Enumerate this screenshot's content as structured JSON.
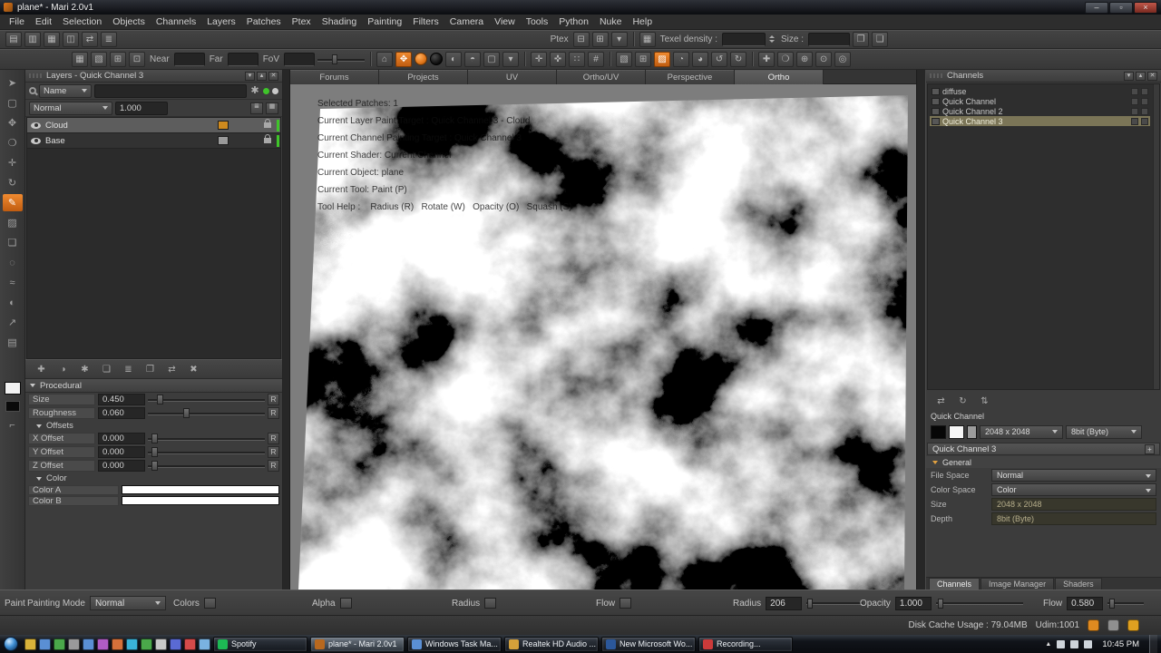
{
  "colors": {
    "accent_orange": "#e0761a",
    "indicator_green": "#3fc42a",
    "selected_channel_olive": "#7b7557"
  },
  "window": {
    "title": "plane* - Mari 2.0v1",
    "minimize_label": "–",
    "maximize_label": "▫",
    "close_label": "×"
  },
  "menubar": {
    "items": [
      "File",
      "Edit",
      "Selection",
      "Objects",
      "Channels",
      "Layers",
      "Patches",
      "Ptex",
      "Shading",
      "Painting",
      "Filters",
      "Camera",
      "View",
      "Tools",
      "Python",
      "Nuke",
      "Help"
    ]
  },
  "toolbar1": {
    "left_icons": [
      {
        "name": "new-project-icon",
        "glyph": "▤"
      },
      {
        "name": "open-project-icon",
        "glyph": "▥"
      },
      {
        "name": "save-project-icon",
        "glyph": "▦"
      },
      {
        "name": "import-archive-icon",
        "glyph": "◫"
      },
      {
        "name": "export-archive-icon",
        "glyph": "⇄"
      },
      {
        "name": "session-settings-icon",
        "glyph": "≣"
      }
    ],
    "ptex_label": "Ptex",
    "ptex_icons": [
      {
        "name": "ptex-decrease-res-icon",
        "glyph": "⊟"
      },
      {
        "name": "ptex-increase-res-icon",
        "glyph": "⊞"
      },
      {
        "name": "ptex-world-scale-icon",
        "glyph": "▾"
      }
    ],
    "screen_icon_glyph": "▦",
    "texel_density_label": "Texel density :",
    "size_label": "Size :",
    "right_icons": [
      {
        "name": "copy-resolution-icon",
        "glyph": "❐"
      },
      {
        "name": "paste-resolution-icon",
        "glyph": "❏"
      }
    ]
  },
  "toolbar2": {
    "left_icons": [
      {
        "name": "grid-snap-icon",
        "glyph": "▦"
      },
      {
        "name": "uv-grid-icon",
        "glyph": "▧"
      },
      {
        "name": "mirror-x-icon",
        "glyph": "⊞"
      },
      {
        "name": "mirror-y-icon",
        "glyph": "⊡"
      }
    ],
    "near_label": "Near",
    "far_label": "Far",
    "fov_label": "FoV",
    "icons": [
      {
        "name": "home-view-icon",
        "glyph": "⌂"
      },
      {
        "name": "pan-lock-icon",
        "glyph": "✥",
        "cls": "active-orange"
      },
      {
        "name": "foreground-color-swatch",
        "glyph": "",
        "cls": "dot-orange"
      },
      {
        "name": "background-color-swatch",
        "glyph": "",
        "cls": "dot-black"
      },
      {
        "name": "shaded-sphere-icon",
        "glyph": "◐"
      },
      {
        "name": "flat-sphere-icon",
        "glyph": "◓"
      },
      {
        "name": "color-swatch-icon",
        "glyph": "▢"
      },
      {
        "name": "brush-preset-dropdown",
        "glyph": "▾"
      },
      {
        "name": "separator",
        "glyph": "",
        "cls": "sep"
      },
      {
        "name": "mirror-paint-icon",
        "glyph": "✛"
      },
      {
        "name": "symmetry-paint-icon",
        "glyph": "✜"
      },
      {
        "name": "tile-paint-icon",
        "glyph": "∷"
      },
      {
        "name": "grid-paint-icon",
        "glyph": "#"
      },
      {
        "name": "separator",
        "glyph": "",
        "cls": "sep"
      },
      {
        "name": "paint-through-icon",
        "glyph": "▧"
      },
      {
        "name": "paint-buffer-icon",
        "glyph": "⊞"
      },
      {
        "name": "projection-mode-icon",
        "glyph": "▨",
        "cls": "active-orange"
      },
      {
        "name": "sphere-map-icon",
        "glyph": "◔"
      },
      {
        "name": "environment-icon",
        "glyph": "◕"
      },
      {
        "name": "undo-icon",
        "glyph": "↺"
      },
      {
        "name": "redo-icon",
        "glyph": "↻"
      },
      {
        "name": "separator",
        "glyph": "",
        "cls": "sep"
      },
      {
        "name": "add-view-icon",
        "glyph": "✚"
      },
      {
        "name": "ellipse-select-icon",
        "glyph": "❍"
      },
      {
        "name": "zoom-in-icon",
        "glyph": "⊕"
      },
      {
        "name": "focus-selected-icon",
        "glyph": "⊙"
      },
      {
        "name": "target-view-icon",
        "glyph": "◎"
      }
    ]
  },
  "left_tools": [
    {
      "name": "select-tool-icon",
      "glyph": "➤"
    },
    {
      "name": "marquee-select-icon",
      "glyph": "▢"
    },
    {
      "name": "pan-tool-icon",
      "glyph": "✥"
    },
    {
      "name": "zoom-tool-icon",
      "glyph": "❍"
    },
    {
      "name": "move-tool-icon",
      "glyph": "✛"
    },
    {
      "name": "rotate-tool-icon",
      "glyph": "↻"
    },
    {
      "name": "paint-tool-icon",
      "glyph": "✎",
      "cls": "active"
    },
    {
      "name": "eraser-tool-icon",
      "glyph": "▨"
    },
    {
      "name": "clone-stamp-icon",
      "glyph": "❏"
    },
    {
      "name": "blur-tool-icon",
      "glyph": "◌"
    },
    {
      "name": "smear-tool-icon",
      "glyph": "≈"
    },
    {
      "name": "dodge-tool-icon",
      "glyph": "◐"
    },
    {
      "name": "vector-paint-icon",
      "glyph": "↗"
    },
    {
      "name": "gradient-tool-icon",
      "glyph": "▤"
    }
  ],
  "panel_buttons": [
    {
      "name": "panel-menu-icon",
      "glyph": "▾"
    },
    {
      "name": "panel-float-icon",
      "glyph": "▴"
    },
    {
      "name": "panel-close-icon",
      "glyph": "✕"
    }
  ],
  "layers_panel": {
    "title": "Layers - Quick Channel 3",
    "filter_field_label": "Name",
    "blend_mode": "Normal",
    "blend_amount": "1.000",
    "layers": [
      {
        "name": "Cloud",
        "cls": "selected",
        "badge_color": "#cf8a1e"
      },
      {
        "name": "Base",
        "badge_color": "#9a9a9a"
      }
    ],
    "footer_icons": [
      {
        "name": "add-layer-icon",
        "glyph": "✚"
      },
      {
        "name": "add-adjustment-layer-icon",
        "glyph": "◑"
      },
      {
        "name": "add-procedural-layer-icon",
        "glyph": "✱"
      },
      {
        "name": "add-group-icon",
        "glyph": "❏"
      },
      {
        "name": "merge-layers-icon",
        "glyph": "≣"
      },
      {
        "name": "duplicate-layer-icon",
        "glyph": "❐"
      },
      {
        "name": "transfer-layer-icon",
        "glyph": "⇄"
      },
      {
        "name": "remove-layer-icon",
        "glyph": "✖"
      }
    ]
  },
  "procedural_panel": {
    "title": "Procedural",
    "reset_label": "R",
    "sliders": [
      {
        "label": "Size",
        "value": "0.450",
        "pos": 8
      },
      {
        "label": "Roughness",
        "value": "0.060",
        "pos": 30
      }
    ],
    "offsets_title": "Offsets",
    "offsets": [
      {
        "label": "X Offset",
        "value": "0.000",
        "pos": 3
      },
      {
        "label": "Y Offset",
        "value": "0.000",
        "pos": 3
      },
      {
        "label": "Z Offset",
        "value": "0.000",
        "pos": 3
      }
    ],
    "color_title": "Color",
    "color_rows": [
      {
        "label": "Color A",
        "color": "#ffffff"
      },
      {
        "label": "Color B",
        "color": "#ffffff"
      }
    ]
  },
  "viewport": {
    "tabs": [
      {
        "label": "Forums"
      },
      {
        "label": "Projects"
      },
      {
        "label": "UV"
      },
      {
        "label": "Ortho/UV"
      },
      {
        "label": "Perspective"
      },
      {
        "label": "Ortho",
        "cls": "active"
      }
    ],
    "hud_lines": [
      "Selected Patches: 1",
      "Current Layer Paint Target : Quick Channel 3 - Cloud",
      "Current Channel Painting Target : Quick Channel 3",
      "Current Shader: Current Channel",
      "Current Object: plane",
      "Current Tool: Paint (P)",
      "Tool Help :    Radius (R)   Rotate (W)   Opacity (O)   Squash (S)"
    ]
  },
  "channels_panel": {
    "title": "Channels",
    "channels": [
      {
        "name": "diffuse"
      },
      {
        "name": "Quick Channel"
      },
      {
        "name": "Quick Channel 2"
      },
      {
        "name": "Quick Channel 3",
        "cls": "selected"
      }
    ],
    "action_icons": [
      {
        "name": "transfer-channel-icon",
        "glyph": "⇄"
      },
      {
        "name": "sync-channel-icon",
        "glyph": "↻"
      },
      {
        "name": "export-channel-icon",
        "glyph": "⇅"
      }
    ],
    "quick_channel_label": "Quick Channel",
    "size_dropdown_value": "2048 x 2048",
    "depth_dropdown_value": "8bit  (Byte)",
    "properties_title": "Quick Channel 3",
    "properties_add_label": "+",
    "general_title": "General",
    "properties": [
      {
        "label": "File Space",
        "value": "Normal",
        "is_dropdown": true,
        "name": "file-space-dropdown"
      },
      {
        "label": "Color Space",
        "value": "Color",
        "is_dropdown": true,
        "name": "color-space-dropdown"
      },
      {
        "label": "Size",
        "value": "2048 x 2048",
        "name": "channel-size-value"
      },
      {
        "label": "Depth",
        "value": "8bit  (Byte)",
        "name": "channel-depth-value"
      }
    ],
    "bottom_tabs": [
      {
        "label": "Channels",
        "cls": "active"
      },
      {
        "label": "Image Manager"
      },
      {
        "label": "Shaders"
      }
    ]
  },
  "paint_bar": {
    "panel_label": "Paint",
    "painting_mode_label": "Painting Mode",
    "painting_mode_value": "Normal",
    "colors_label": "Colors",
    "alpha_label": "Alpha",
    "radius_chip_label": "Radius",
    "flow_chip_label": "Flow",
    "radius_label": "Radius",
    "radius_value": "206",
    "opacity_label": "Opacity",
    "opacity_value": "1.000",
    "flow_label": "Flow",
    "flow_value": "0.580"
  },
  "status_bar": {
    "disk_cache_text": "Disk Cache Usage : 79.04MB",
    "udim_text": "Udim:1001",
    "icons": [
      {
        "name": "status-warning-icon",
        "color": "#e08a20"
      },
      {
        "name": "status-info-icon",
        "color": "#8f8f8f"
      },
      {
        "name": "status-activity-icon",
        "color": "#e0a020"
      }
    ]
  },
  "taskbar": {
    "quicklaunch": [
      {
        "name": "quicklaunch-icon",
        "color": "#d8b23a"
      },
      {
        "name": "quicklaunch-icon",
        "color": "#5a8fd4"
      },
      {
        "name": "quicklaunch-icon",
        "color": "#4aa84a"
      },
      {
        "name": "quicklaunch-icon",
        "color": "#9a9a9a"
      },
      {
        "name": "quicklaunch-icon",
        "color": "#5a8fd4"
      },
      {
        "name": "quicklaunch-icon",
        "color": "#b05cc4"
      },
      {
        "name": "quicklaunch-icon",
        "color": "#d4703a"
      },
      {
        "name": "quicklaunch-icon",
        "color": "#3ab2d8"
      },
      {
        "name": "quicklaunch-icon",
        "color": "#4aa84a"
      },
      {
        "name": "quicklaunch-icon",
        "color": "#c8c8c8"
      },
      {
        "name": "quicklaunch-icon",
        "color": "#5a6ad4"
      },
      {
        "name": "quicklaunch-icon",
        "color": "#d44a4a"
      },
      {
        "name": "quicklaunch-icon",
        "color": "#7ab2e0"
      }
    ],
    "buttons": [
      {
        "label": "Spotify",
        "icon_name": "spotify-icon",
        "icon_color": "#1db954"
      },
      {
        "label": "plane* - Mari 2.0v1",
        "icon_name": "mari-icon",
        "icon_color": "#b8681e",
        "cls": "active"
      },
      {
        "label": "Windows Task Ma...",
        "icon_name": "task-manager-icon",
        "icon_color": "#5a8fd4"
      },
      {
        "label": "Realtek HD Audio ...",
        "icon_name": "realtek-audio-icon",
        "icon_color": "#d4a03a"
      },
      {
        "label": "New Microsoft Wo...",
        "icon_name": "word-icon",
        "icon_color": "#2b579a"
      },
      {
        "label": "Recording...",
        "icon_name": "recording-icon",
        "icon_color": "#cc3a3a"
      }
    ],
    "time": "10:45 PM"
  }
}
